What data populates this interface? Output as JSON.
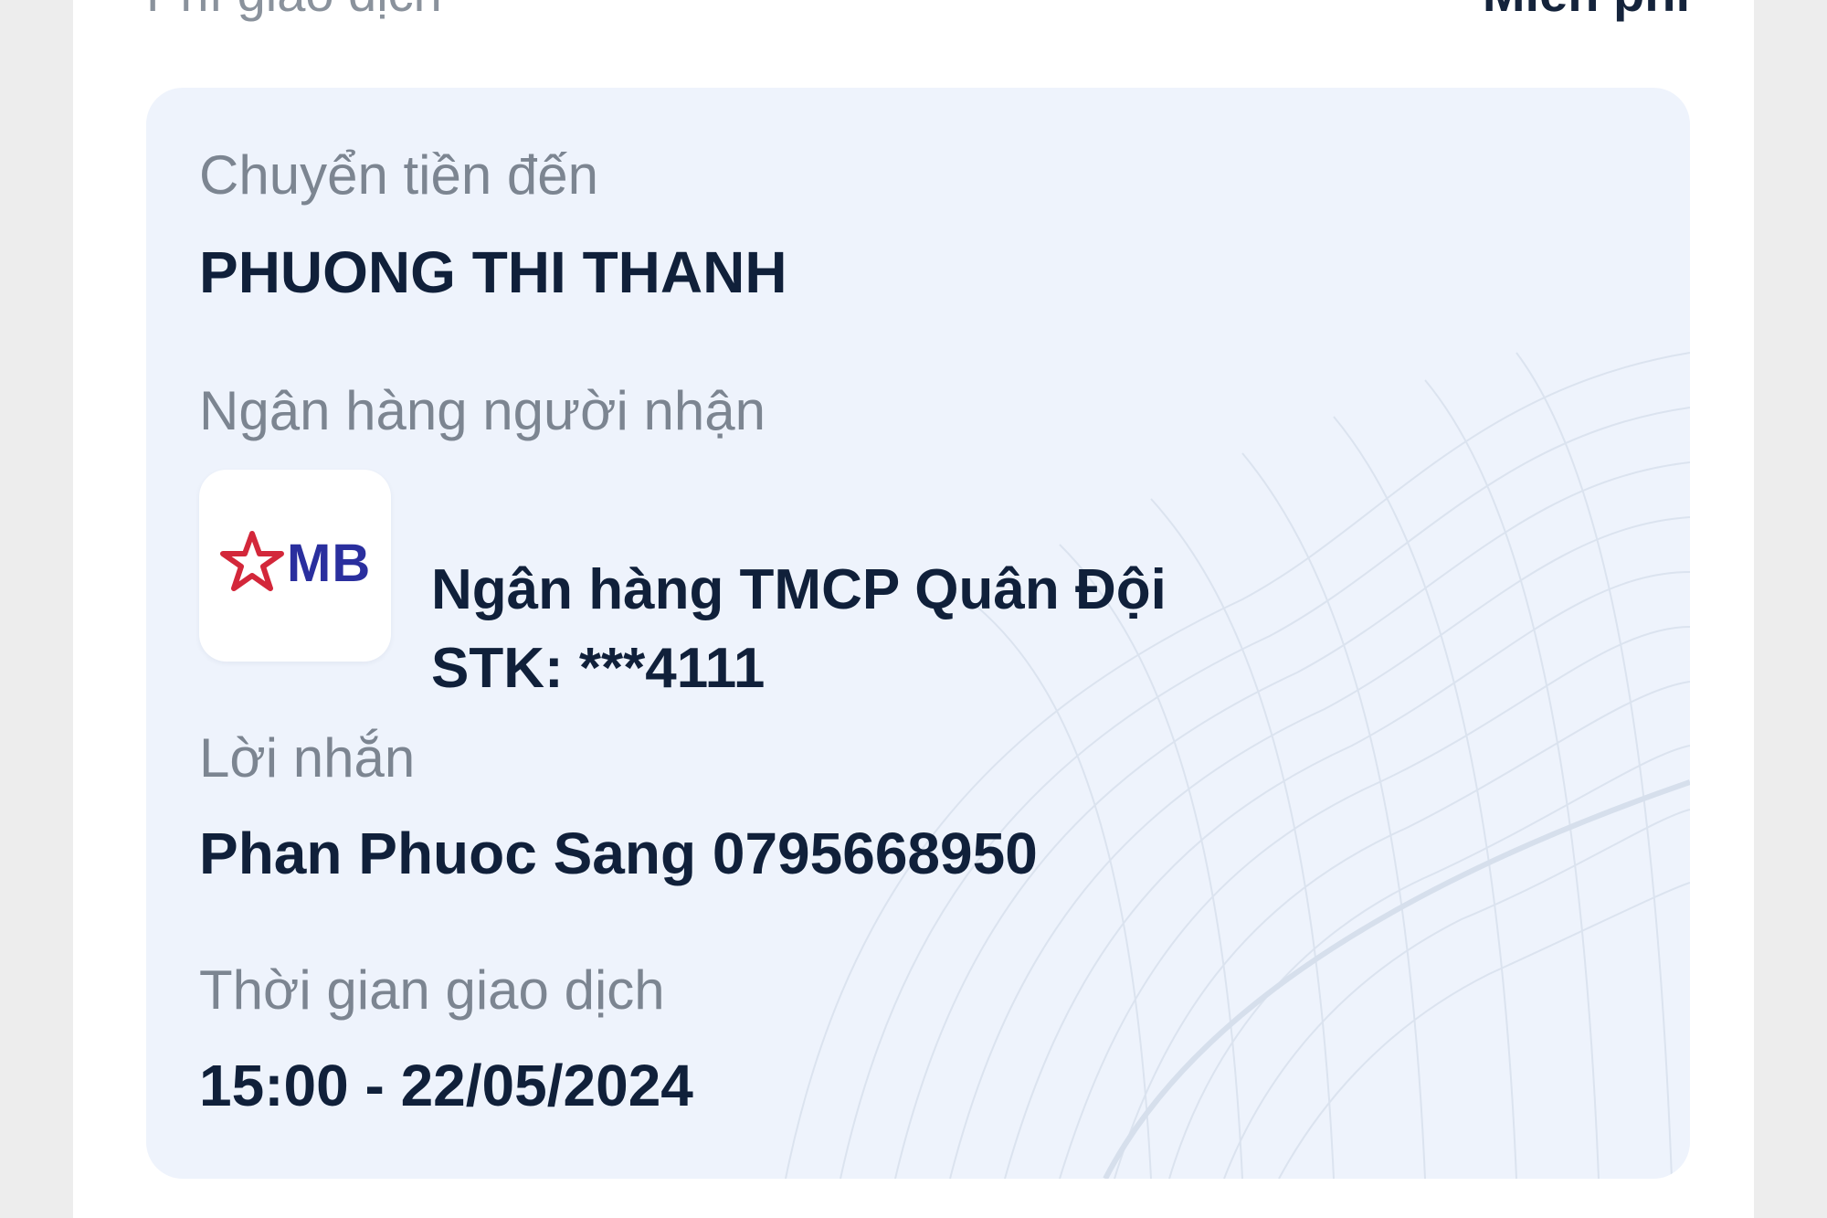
{
  "header": {
    "fee_label": "Phí giao dịch",
    "fee_value": "Miễn phí"
  },
  "transfer": {
    "to_label": "Chuyển tiền đến",
    "recipient_name": "PHUONG THI THANH",
    "bank_label": "Ngân hàng người nhận",
    "bank_logo_text": "MB",
    "bank_name": "Ngân hàng TMCP Quân Đội",
    "account_prefix": "STK: ",
    "account_number": "***4111",
    "message_label": "Lời nhắn",
    "message_value": "Phan Phuoc Sang 0795668950",
    "time_label": "Thời gian giao dịch",
    "time_value": "15:00 - 22/05/2024"
  },
  "colors": {
    "card_background": "#eef3fc",
    "primary_text": "#10203a",
    "secondary_text": "#7c8591",
    "mb_logo_blue": "#2a2f9e",
    "mb_logo_red": "#d3273a"
  }
}
